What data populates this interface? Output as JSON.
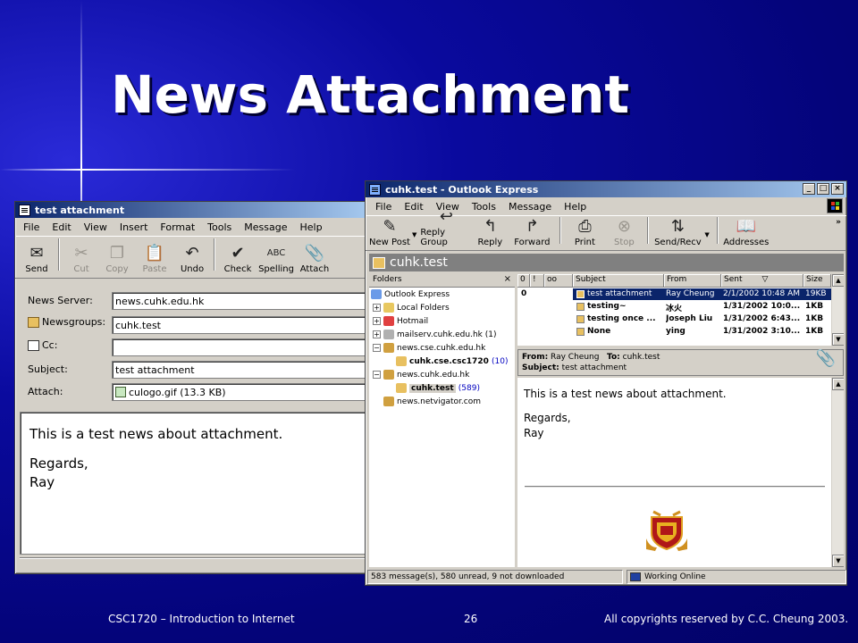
{
  "slide": {
    "title": "News Attachment",
    "footer_left": "CSC1720 – Introduction to Internet",
    "footer_page": "26",
    "footer_right": "All copyrights reserved by C.C. Cheung 2003."
  },
  "compose": {
    "title": "test attachment",
    "menu": [
      "File",
      "Edit",
      "View",
      "Insert",
      "Format",
      "Tools",
      "Message",
      "Help"
    ],
    "toolbar": [
      {
        "label": "Send",
        "icon": "send-icon"
      },
      {
        "label": "Cut",
        "icon": "scissors-icon"
      },
      {
        "label": "Copy",
        "icon": "copy-icon"
      },
      {
        "label": "Paste",
        "icon": "paste-icon"
      },
      {
        "label": "Undo",
        "icon": "undo-icon"
      },
      {
        "label": "Check",
        "icon": "check-names-icon"
      },
      {
        "label": "Spelling",
        "icon": "spelling-icon"
      },
      {
        "label": "Attach",
        "icon": "paperclip-icon"
      }
    ],
    "labels": {
      "server": "News Server:",
      "newsgroups": "Newsgroups:",
      "cc": "Cc:",
      "subject": "Subject:",
      "attach": "Attach:"
    },
    "values": {
      "server": "news.cuhk.edu.hk",
      "newsgroups": "cuhk.test",
      "cc": "",
      "subject": "test attachment",
      "attach": "culogo.gif (13.3 KB)"
    },
    "body": {
      "line1": "This is a test news about attachment.",
      "line2": "Regards,",
      "line3": "Ray"
    }
  },
  "outlook": {
    "title": "cuhk.test - Outlook Express",
    "menu": [
      "File",
      "Edit",
      "View",
      "Tools",
      "Message",
      "Help"
    ],
    "toolbar": [
      {
        "label": "New Post",
        "icon": "new-post-icon"
      },
      {
        "label": "Reply Group",
        "icon": "reply-group-icon"
      },
      {
        "label": "Reply",
        "icon": "reply-icon"
      },
      {
        "label": "Forward",
        "icon": "forward-icon"
      },
      {
        "label": "Print",
        "icon": "printer-icon"
      },
      {
        "label": "Stop",
        "icon": "stop-icon"
      },
      {
        "label": "Send/Recv",
        "icon": "send-receive-icon"
      },
      {
        "label": "Addresses",
        "icon": "address-book-icon"
      }
    ],
    "group_header": "cuhk.test",
    "folders_title": "Folders",
    "folders": [
      {
        "label": "Outlook Express",
        "count": ""
      },
      {
        "label": "Local Folders",
        "count": ""
      },
      {
        "label": "Hotmail",
        "count": ""
      },
      {
        "label": "mailserv.cuhk.edu.hk",
        "count": "(1)"
      },
      {
        "label": "news.cse.cuhk.edu.hk",
        "count": ""
      },
      {
        "label": "cuhk.cse.csc1720",
        "count": "(10)"
      },
      {
        "label": "news.cuhk.edu.hk",
        "count": ""
      },
      {
        "label": "cuhk.test",
        "count": "(589)"
      },
      {
        "label": "news.netvigator.com",
        "count": ""
      }
    ],
    "columns": {
      "subject": "Subject",
      "from": "From",
      "sent": "Sent",
      "size": "Size"
    },
    "messages": [
      {
        "subject": "test attachment",
        "from": "Ray Cheung",
        "sent": "2/1/2002 10:48 AM",
        "size": "19KB"
      },
      {
        "subject": "testing~",
        "from": "冰火",
        "sent": "1/31/2002 10:0...",
        "size": "1KB"
      },
      {
        "subject": "testing once ...",
        "from": "Joseph Liu",
        "sent": "1/31/2002 6:43...",
        "size": "1KB"
      },
      {
        "subject": "None",
        "from": "ying",
        "sent": "1/31/2002 3:10...",
        "size": "1KB"
      }
    ],
    "preview": {
      "from_label": "From:",
      "from": "Ray Cheung",
      "to_label": "To:",
      "to": "cuhk.test",
      "subject_label": "Subject:",
      "subject": "test attachment",
      "line1": "This is a test news about attachment.",
      "line2": "Regards,",
      "line3": "Ray"
    },
    "status": {
      "messages": "583 message(s), 580 unread, 9 not downloaded",
      "online": "Working Online"
    }
  }
}
